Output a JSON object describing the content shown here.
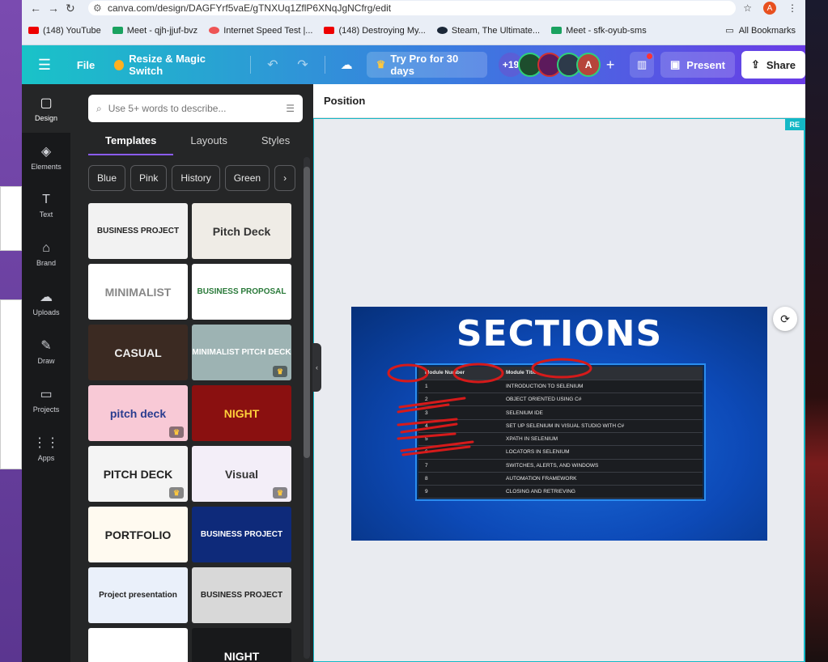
{
  "browser": {
    "url": "canva.com/design/DAGFYrf5vaE/gTNXUq1ZflP6XNqJgNCfrg/edit",
    "profile_initial": "A",
    "bookmarks": [
      {
        "label": "(148) YouTube",
        "icon": "youtube-icon",
        "color": "#e00"
      },
      {
        "label": "Meet - qjh-jjuf-bvz",
        "icon": "meet-icon",
        "color": "#1aa260"
      },
      {
        "label": "Internet Speed Test |...",
        "icon": "speedtest-icon",
        "color": "#e55"
      },
      {
        "label": "(148) Destroying My...",
        "icon": "youtube-icon",
        "color": "#e00"
      },
      {
        "label": "Steam, The Ultimate...",
        "icon": "steam-icon",
        "color": "#1b2838"
      },
      {
        "label": "Meet - sfk-oyub-sms",
        "icon": "meet-icon",
        "color": "#1aa260"
      }
    ],
    "all_bookmarks": "All Bookmarks"
  },
  "header": {
    "file": "File",
    "resize": "Resize & Magic Switch",
    "try_pro": "Try Pro for 30 days",
    "collab_count": "+19",
    "avatar_letter": "A",
    "present": "Present",
    "share": "Share"
  },
  "rail": [
    {
      "label": "Design",
      "icon": "▢"
    },
    {
      "label": "Elements",
      "icon": "◈"
    },
    {
      "label": "Text",
      "icon": "T"
    },
    {
      "label": "Brand",
      "icon": "⌂"
    },
    {
      "label": "Uploads",
      "icon": "☁"
    },
    {
      "label": "Draw",
      "icon": "✎"
    },
    {
      "label": "Projects",
      "icon": "▭"
    },
    {
      "label": "Apps",
      "icon": "⋮⋮"
    }
  ],
  "panel": {
    "search_placeholder": "Use 5+ words to describe...",
    "tabs": [
      "Templates",
      "Layouts",
      "Styles"
    ],
    "chips": [
      "Blue",
      "Pink",
      "History",
      "Green"
    ],
    "templates": [
      {
        "label": "BUSINESS PROJECT",
        "bg": "#f2f2f2",
        "fg": "#222",
        "pro": false
      },
      {
        "label": "Pitch Deck",
        "bg": "#efece6",
        "fg": "#333",
        "pro": false
      },
      {
        "label": "MINIMALIST",
        "bg": "#ffffff",
        "fg": "#888",
        "pro": false
      },
      {
        "label": "BUSINESS PROPOSAL",
        "bg": "#ffffff",
        "fg": "#2a7a3a",
        "pro": false
      },
      {
        "label": "CASUAL",
        "bg": "#3b2a22",
        "fg": "#eee",
        "pro": false
      },
      {
        "label": "MINIMALIST PITCH DECK",
        "bg": "#9db3b3",
        "fg": "#fff",
        "pro": true
      },
      {
        "label": "pitch deck",
        "bg": "#f8c9d6",
        "fg": "#2a3d8f",
        "pro": true
      },
      {
        "label": "NIGHT",
        "bg": "#8a1010",
        "fg": "#ffcf3a",
        "pro": false
      },
      {
        "label": "PITCH DECK",
        "bg": "#f4f4f4",
        "fg": "#222",
        "pro": true
      },
      {
        "label": "Visual",
        "bg": "#f3eef8",
        "fg": "#333",
        "pro": true
      },
      {
        "label": "PORTFOLIO",
        "bg": "#fffaf0",
        "fg": "#222",
        "pro": false
      },
      {
        "label": "BUSINESS PROJECT",
        "bg": "#0e2a7a",
        "fg": "#fff",
        "pro": false
      },
      {
        "label": "Project presentation",
        "bg": "#eaf0fa",
        "fg": "#222",
        "pro": false
      },
      {
        "label": "BUSINESS PROJECT",
        "bg": "#d8d8d8",
        "fg": "#222",
        "pro": false
      },
      {
        "label": "",
        "bg": "#ffffff",
        "fg": "#333",
        "pro": false
      },
      {
        "label": "NIGHT",
        "bg": "#18191b",
        "fg": "#fff",
        "pro": false
      }
    ]
  },
  "editor": {
    "heading": "Position",
    "page_tag": "RE"
  },
  "slide": {
    "title": "SECTIONS",
    "table_header": [
      "Module Number",
      "Module Title"
    ],
    "rows": [
      [
        "1",
        "INTRODUCTION TO SELENIUM"
      ],
      [
        "2",
        "OBJECT ORIENTED USING C#"
      ],
      [
        "3",
        "SELENIUM IDE"
      ],
      [
        "4",
        "SET UP SELENIUM IN VISUAL STUDIO WITH C#"
      ],
      [
        "5",
        "XPATH IN SELENIUM"
      ],
      [
        "6",
        "LOCATORS IN SELENIUM"
      ],
      [
        "7",
        "SWITCHES, ALERTS, AND WINDOWS"
      ],
      [
        "8",
        "AUTOMATION FRAMEWORK"
      ],
      [
        "9",
        "CLOSING AND RETRIEVING"
      ]
    ],
    "annotation_color": "#d61a1a"
  }
}
